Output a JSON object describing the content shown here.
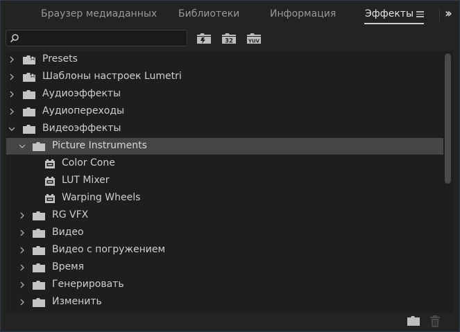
{
  "tabs": [
    {
      "label": "Браузер медиаданных",
      "active": false
    },
    {
      "label": "Библиотеки",
      "active": false
    },
    {
      "label": "Информация",
      "active": false
    },
    {
      "label": "Эффекты",
      "active": true
    }
  ],
  "toolbar": {
    "search_value": "",
    "icons": [
      "accelerated-effects-icon",
      "32-bit-color-icon",
      "yuv-effects-icon"
    ]
  },
  "tree": [
    {
      "label": "Presets",
      "level": 0,
      "type": "folder-star",
      "expanded": false
    },
    {
      "label": "Шаблоны настроек Lumetri",
      "level": 0,
      "type": "folder-star",
      "expanded": false
    },
    {
      "label": "Аудиоэффекты",
      "level": 0,
      "type": "folder",
      "expanded": false
    },
    {
      "label": "Аудиопереходы",
      "level": 0,
      "type": "folder",
      "expanded": false
    },
    {
      "label": "Видеоэффекты",
      "level": 0,
      "type": "folder",
      "expanded": true
    },
    {
      "label": "Picture Instruments",
      "level": 1,
      "type": "folder",
      "expanded": true,
      "selected": true
    },
    {
      "label": "Color Cone",
      "level": 2,
      "type": "effect"
    },
    {
      "label": "LUT Mixer",
      "level": 2,
      "type": "effect"
    },
    {
      "label": "Warping Wheels",
      "level": 2,
      "type": "effect"
    },
    {
      "label": "RG VFX",
      "level": 1,
      "type": "folder",
      "expanded": false
    },
    {
      "label": "Видео",
      "level": 1,
      "type": "folder",
      "expanded": false
    },
    {
      "label": "Видео с погружением",
      "level": 1,
      "type": "folder",
      "expanded": false
    },
    {
      "label": "Время",
      "level": 1,
      "type": "folder",
      "expanded": false
    },
    {
      "label": "Генерировать",
      "level": 1,
      "type": "folder",
      "expanded": false
    },
    {
      "label": "Изменить",
      "level": 1,
      "type": "folder",
      "expanded": false
    }
  ],
  "footer": {
    "icons": [
      "new-bin-icon",
      "trash-icon"
    ]
  }
}
